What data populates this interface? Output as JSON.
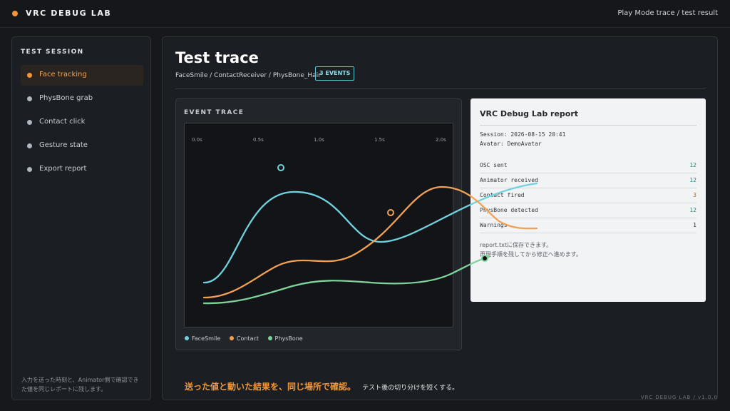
{
  "app": {
    "name": "VRC DEBUG LAB",
    "context": "Play Mode trace / test result",
    "version": "VRC DEBUG LAB / v1.0.0"
  },
  "sidebar": {
    "title": "TEST SESSION",
    "items": [
      {
        "label": "Face tracking",
        "active": true
      },
      {
        "label": "PhysBone grab",
        "active": false
      },
      {
        "label": "Contact click",
        "active": false
      },
      {
        "label": "Gesture state",
        "active": false
      },
      {
        "label": "Export report",
        "active": false
      }
    ],
    "note": "入力を送った時刻と、Animator側で確認できた値を同じレポートに残します。"
  },
  "main": {
    "title": "Test trace",
    "breadcrumb": "FaceSmile / ContactReceiver / PhysBone_Hair",
    "badge": "3 EVENTS"
  },
  "trace": {
    "title": "EVENT TRACE",
    "ticks": [
      "0.0s",
      "0.5s",
      "1.0s",
      "1.5s",
      "2.0s"
    ],
    "legend": [
      "FaceSmile",
      "Contact",
      "PhysBone"
    ],
    "colors": {
      "FaceSmile": "#6fd3df",
      "Contact": "#f2a154",
      "PhysBone": "#7fd39a"
    }
  },
  "report": {
    "title": "VRC Debug Lab report",
    "session": "Session: 2026-08-15 20:41",
    "avatar": "Avatar: DemoAvatar",
    "rows": [
      {
        "key": "OSC sent",
        "value": "12",
        "color": "#1f8a7a"
      },
      {
        "key": "Animator received",
        "value": "12",
        "color": "#1f8a7a"
      },
      {
        "key": "Contact fired",
        "value": "3",
        "color": "#c26a12"
      },
      {
        "key": "PhysBone detected",
        "value": "12",
        "color": "#1f8a7a"
      },
      {
        "key": "Warnings",
        "value": "1",
        "color": "#2a2d31"
      }
    ],
    "note1": "report.txtに保存できます。",
    "note2": "再現手順を残してから修正へ進めます。"
  },
  "footer": {
    "highlight": "送った値と動いた結果を、同じ場所で確認。",
    "sub": "テスト後の切り分けを短くする。"
  }
}
